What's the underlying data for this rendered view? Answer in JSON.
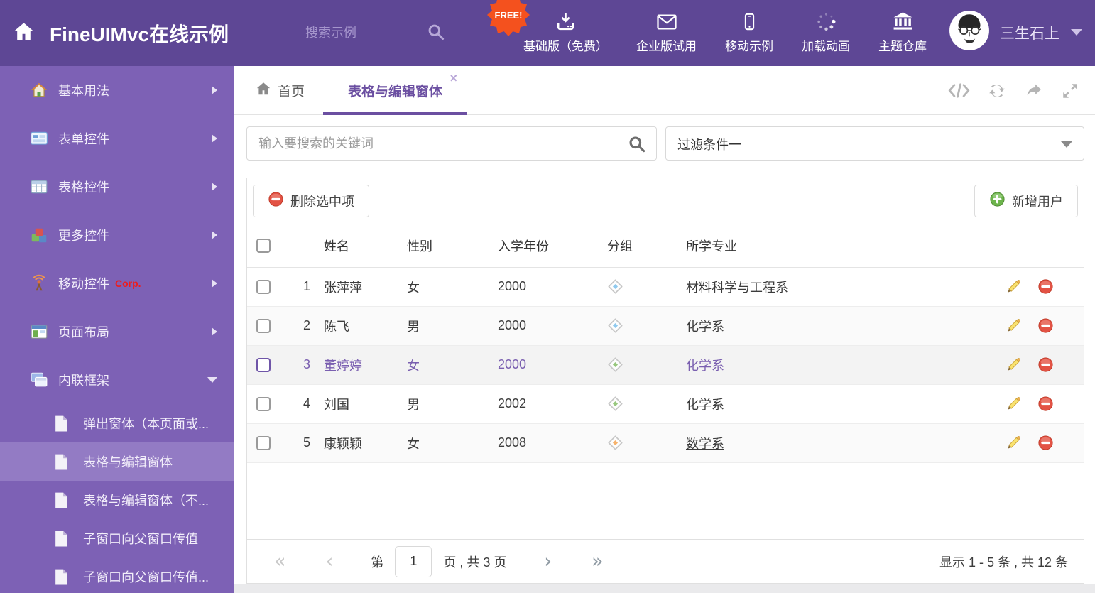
{
  "colors": {
    "header_bg": "#5e4795",
    "sidebar_bg": "#7d61b5",
    "sidebar_active_bg": "#937bc4",
    "accent_purple": "#6b4fa1",
    "free_badge_bg": "#f4511e",
    "delete_red": "#e35244",
    "add_green": "#6db44c"
  },
  "header": {
    "title": "FineUIMvc在线示例",
    "search_placeholder": "搜索示例",
    "free_badge": "FREE!",
    "nav": [
      {
        "icon": "download",
        "label": "基础版（免费）"
      },
      {
        "icon": "envelope",
        "label": "企业版试用"
      },
      {
        "icon": "mobile",
        "label": "移动示例"
      },
      {
        "icon": "spinner",
        "label": "加载动画"
      },
      {
        "icon": "bank",
        "label": "主题仓库"
      }
    ],
    "user": {
      "name": "三生石上"
    }
  },
  "sidebar": {
    "items": [
      {
        "icon": "house",
        "label": "基本用法",
        "chevron": "right"
      },
      {
        "icon": "form",
        "label": "表单控件",
        "chevron": "right"
      },
      {
        "icon": "grid",
        "label": "表格控件",
        "chevron": "right"
      },
      {
        "icon": "cubes",
        "label": "更多控件",
        "chevron": "right"
      },
      {
        "icon": "antenna",
        "label": "移动控件",
        "badge": "Corp.",
        "chevron": "right"
      },
      {
        "icon": "layout",
        "label": "页面布局",
        "chevron": "right"
      },
      {
        "icon": "frames",
        "label": "内联框架",
        "chevron": "down"
      }
    ],
    "subitems": [
      {
        "label": "弹出窗体（本页面或...",
        "active": false
      },
      {
        "label": "表格与编辑窗体",
        "active": true
      },
      {
        "label": "表格与编辑窗体（不...",
        "active": false
      },
      {
        "label": "子窗口向父窗口传值",
        "active": false
      },
      {
        "label": "子窗口向父窗口传值...",
        "active": false
      }
    ]
  },
  "tabs": {
    "home_label": "首页",
    "active_label": "表格与编辑窗体",
    "close_glyph": "×"
  },
  "filterbar": {
    "keyword_placeholder": "输入要搜索的关键词",
    "filter_value": "过滤条件一"
  },
  "toolbar": {
    "delete_label": "删除选中项",
    "add_label": "新增用户"
  },
  "table": {
    "columns": [
      "姓名",
      "性别",
      "入学年份",
      "分组",
      "所学专业"
    ],
    "rows": [
      {
        "num": "1",
        "name": "张萍萍",
        "gender": "女",
        "year": "2000",
        "tag_color": "#8fc9ee",
        "major": "材料科学与工程系",
        "selected": false,
        "alt": false
      },
      {
        "num": "2",
        "name": "陈飞",
        "gender": "男",
        "year": "2000",
        "tag_color": "#8fc9ee",
        "major": "化学系",
        "selected": false,
        "alt": true
      },
      {
        "num": "3",
        "name": "董婷婷",
        "gender": "女",
        "year": "2000",
        "tag_color": "#97c77d",
        "major": "化学系",
        "selected": true,
        "alt": false
      },
      {
        "num": "4",
        "name": "刘国",
        "gender": "男",
        "year": "2002",
        "tag_color": "#97c77d",
        "major": "化学系",
        "selected": false,
        "alt": false
      },
      {
        "num": "5",
        "name": "康颖颖",
        "gender": "女",
        "year": "2008",
        "tag_color": "#f6b26b",
        "major": "数学系",
        "selected": false,
        "alt": true
      }
    ]
  },
  "pagination": {
    "page_label_prefix": "第",
    "current_page": "1",
    "page_label_suffix": "页 , 共 3 页",
    "summary": "显示 1 - 5 条 , 共 12 条"
  }
}
